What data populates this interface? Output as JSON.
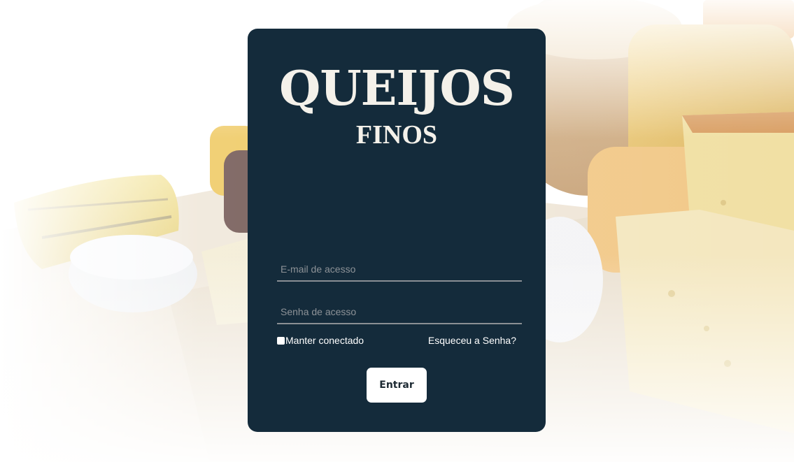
{
  "brand": {
    "title": "QUEIJOS",
    "subtitle": "FINOS"
  },
  "login": {
    "email_placeholder": "E-mail de acesso",
    "password_placeholder": "Senha de acesso",
    "remember_label": "Manter conectado",
    "forgot_label": "Esqueceu a Senha?",
    "submit_label": "Entrar"
  },
  "colors": {
    "card_background": "#142b3b",
    "button_background": "#ffffff",
    "accent_text": "#f4f1ea"
  },
  "icons": {
    "background": "cheese-photo"
  }
}
